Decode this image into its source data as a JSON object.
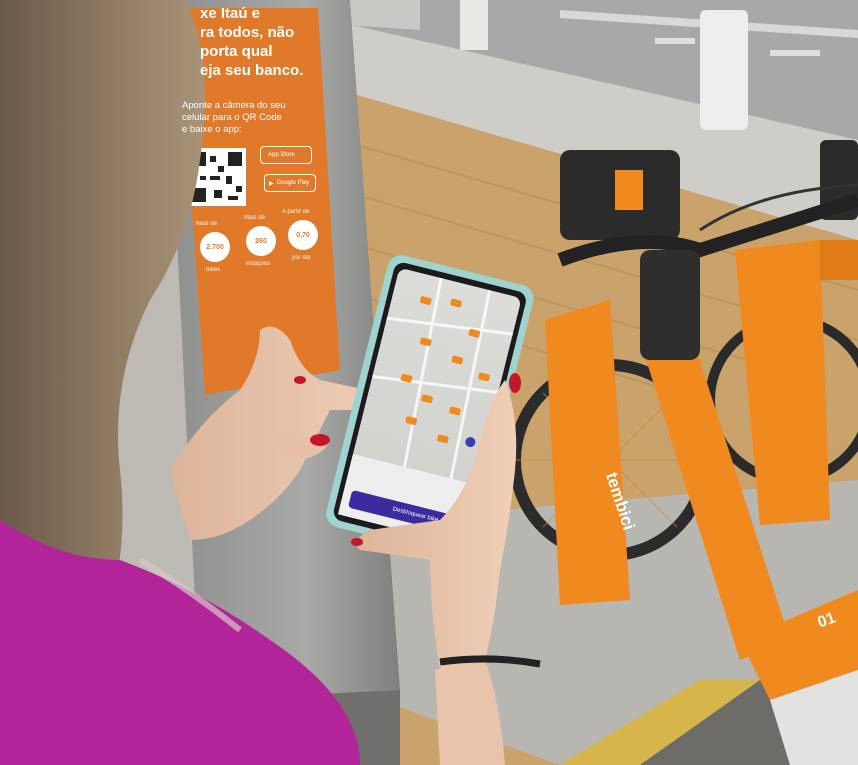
{
  "poster": {
    "headline": [
      "xe Itaú e",
      "ra todos, não",
      "porta qual",
      "eja seu banco."
    ],
    "instruction": [
      "Aponte a câmera do seu",
      "celular para o QR Code",
      "e baixe o app:"
    ],
    "store_buttons": [
      "App Store",
      "Google Play"
    ],
    "stats": [
      {
        "caption": "Mais de",
        "value": "2.700",
        "unit": "bikes"
      },
      {
        "caption": "Mais de",
        "value": "260",
        "unit": "estações"
      },
      {
        "caption": "A partir de",
        "value": "0,70",
        "unit": "por dia"
      }
    ]
  },
  "bike": {
    "brand": "tembici",
    "fender_text": "01"
  },
  "phone": {
    "cta_label": "Desbloquear bike"
  },
  "colors": {
    "poster_orange": "#e07a2a",
    "bike_orange": "#f08a1e",
    "blouse_magenta": "#b2249a",
    "app_purple": "#3b2b9e"
  }
}
